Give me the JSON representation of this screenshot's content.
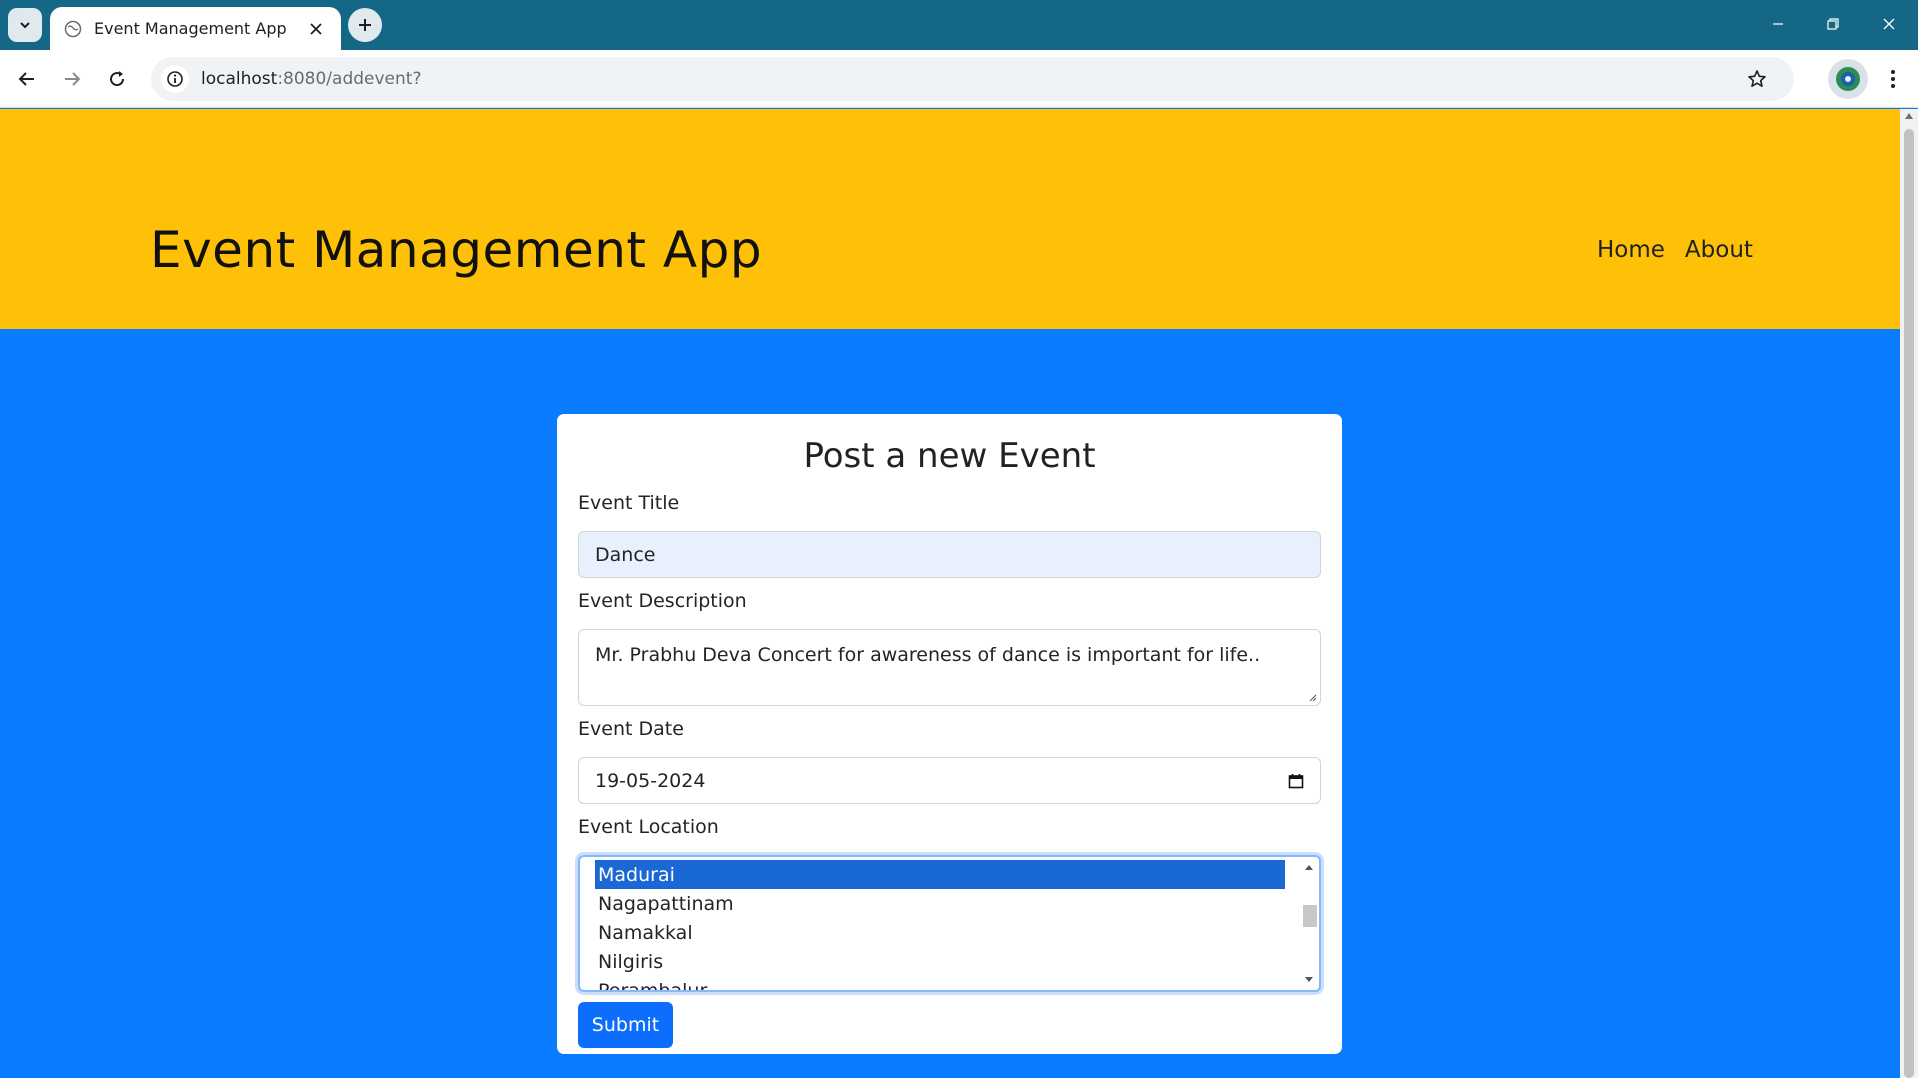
{
  "browser": {
    "tab_title": "Event Management App",
    "url_host": "localhost",
    "url_path": ":8080/addevent?"
  },
  "header": {
    "brand": "Event Management App",
    "nav": [
      "Home",
      "About"
    ]
  },
  "form": {
    "title": "Post a new Event",
    "title_label": "Event Title",
    "title_value": "Dance",
    "description_label": "Event Description",
    "description_value": "Mr. Prabhu Deva Concert for awareness of dance is important for life..",
    "date_label": "Event Date",
    "date_value": "19-05-2024",
    "location_label": "Event Location",
    "location_options": [
      "Madurai",
      "Nagapattinam",
      "Namakkal",
      "Nilgiris",
      "Perambalur"
    ],
    "location_selected": "Madurai",
    "submit_label": "Submit"
  },
  "colors": {
    "header_bg": "#ffc107",
    "page_bg": "#0a7cff",
    "button_bg": "#0d6efd",
    "selected_option_bg": "#1a68d4"
  }
}
